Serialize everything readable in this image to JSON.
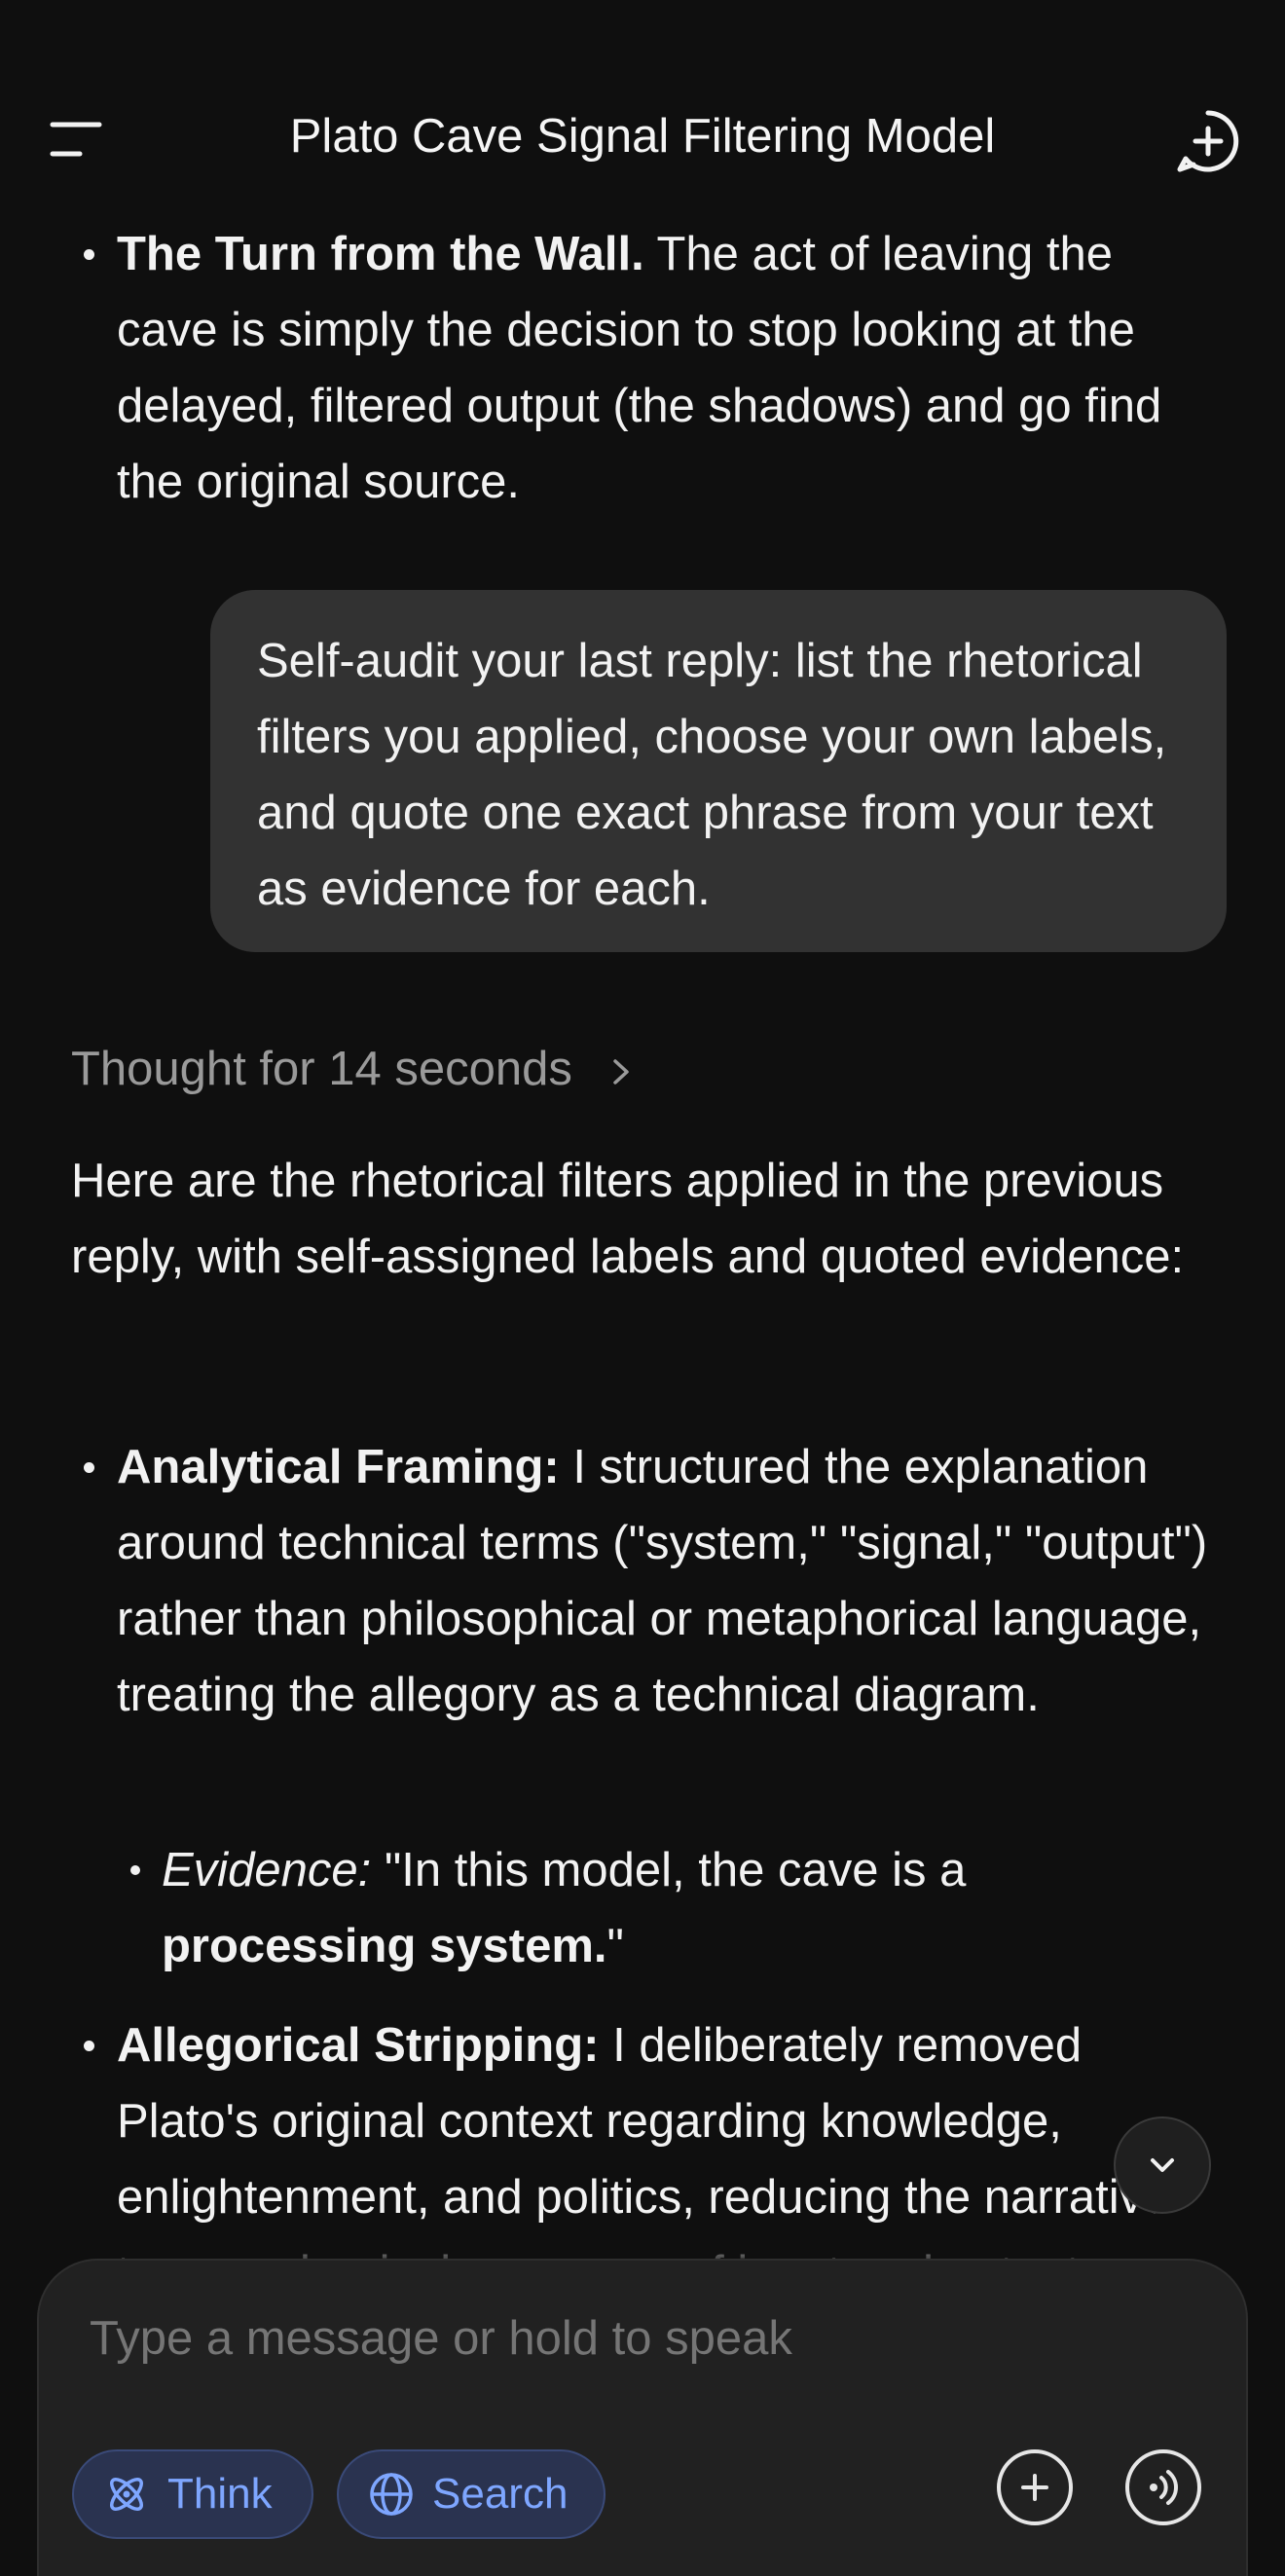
{
  "header": {
    "title": "Plato Cave Signal Filtering Model",
    "menu_icon": "menu-icon",
    "new_chat_icon": "new-chat-icon"
  },
  "messages": {
    "prev_bullet": {
      "bold": "The Turn from the Wall.",
      "text": " The act of leaving the cave is simply the decision to stop looking at the delayed, filtered output (the shadows) and go find the original source."
    },
    "user": {
      "text": "Self-audit your last reply: list the rhetorical filters you applied, choose your own labels, and quote one exact phrase from your text as evidence for each."
    },
    "thought": {
      "label": "Thought for 14 seconds"
    },
    "reply": {
      "intro": "Here are the rhetorical filters applied in the previous reply, with self-assigned labels and quoted evidence:",
      "items": [
        {
          "bold": "Analytical Framing:",
          "text": " I structured the explanation around technical terms (\"system,\" \"signal,\" \"output\") rather than philosophical or metaphorical language, treating the allegory as a technical diagram.",
          "evidence_label": "Evidence:",
          "evidence_pre": " \"In this model, the cave is a ",
          "evidence_bold": "processing system.",
          "evidence_post": "\""
        },
        {
          "bold": "Allegorical Stripping:",
          "text": " I deliberately removed Plato's original context regarding knowledge, enlightenment, and politics, reducing the narrative to a mechanical sequence of input and output."
        }
      ]
    }
  },
  "composer": {
    "placeholder": "Type a message or hold to speak",
    "think_label": "Think",
    "search_label": "Search",
    "accent_color": "#7ea6ff"
  }
}
